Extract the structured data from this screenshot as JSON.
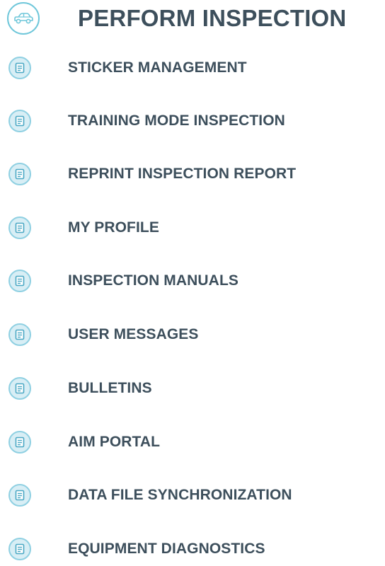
{
  "menu": {
    "header": {
      "title": "PERFORM INSPECTION",
      "icon": "car-icon"
    },
    "items": [
      {
        "label": "STICKER MANAGEMENT",
        "icon": "document-icon"
      },
      {
        "label": "TRAINING MODE INSPECTION",
        "icon": "document-icon"
      },
      {
        "label": "REPRINT INSPECTION REPORT",
        "icon": "document-icon"
      },
      {
        "label": "MY PROFILE",
        "icon": "document-icon"
      },
      {
        "label": "INSPECTION MANUALS",
        "icon": "document-icon"
      },
      {
        "label": "USER MESSAGES",
        "icon": "document-icon"
      },
      {
        "label": "BULLETINS",
        "icon": "document-icon"
      },
      {
        "label": "AIM PORTAL",
        "icon": "document-icon"
      },
      {
        "label": "DATA FILE SYNCHRONIZATION",
        "icon": "document-icon"
      },
      {
        "label": "EQUIPMENT DIAGNOSTICS",
        "icon": "document-icon"
      }
    ]
  },
  "colors": {
    "text": "#3d4f5c",
    "accent": "#6fc7da",
    "icon_fill": "#d8eef5"
  }
}
